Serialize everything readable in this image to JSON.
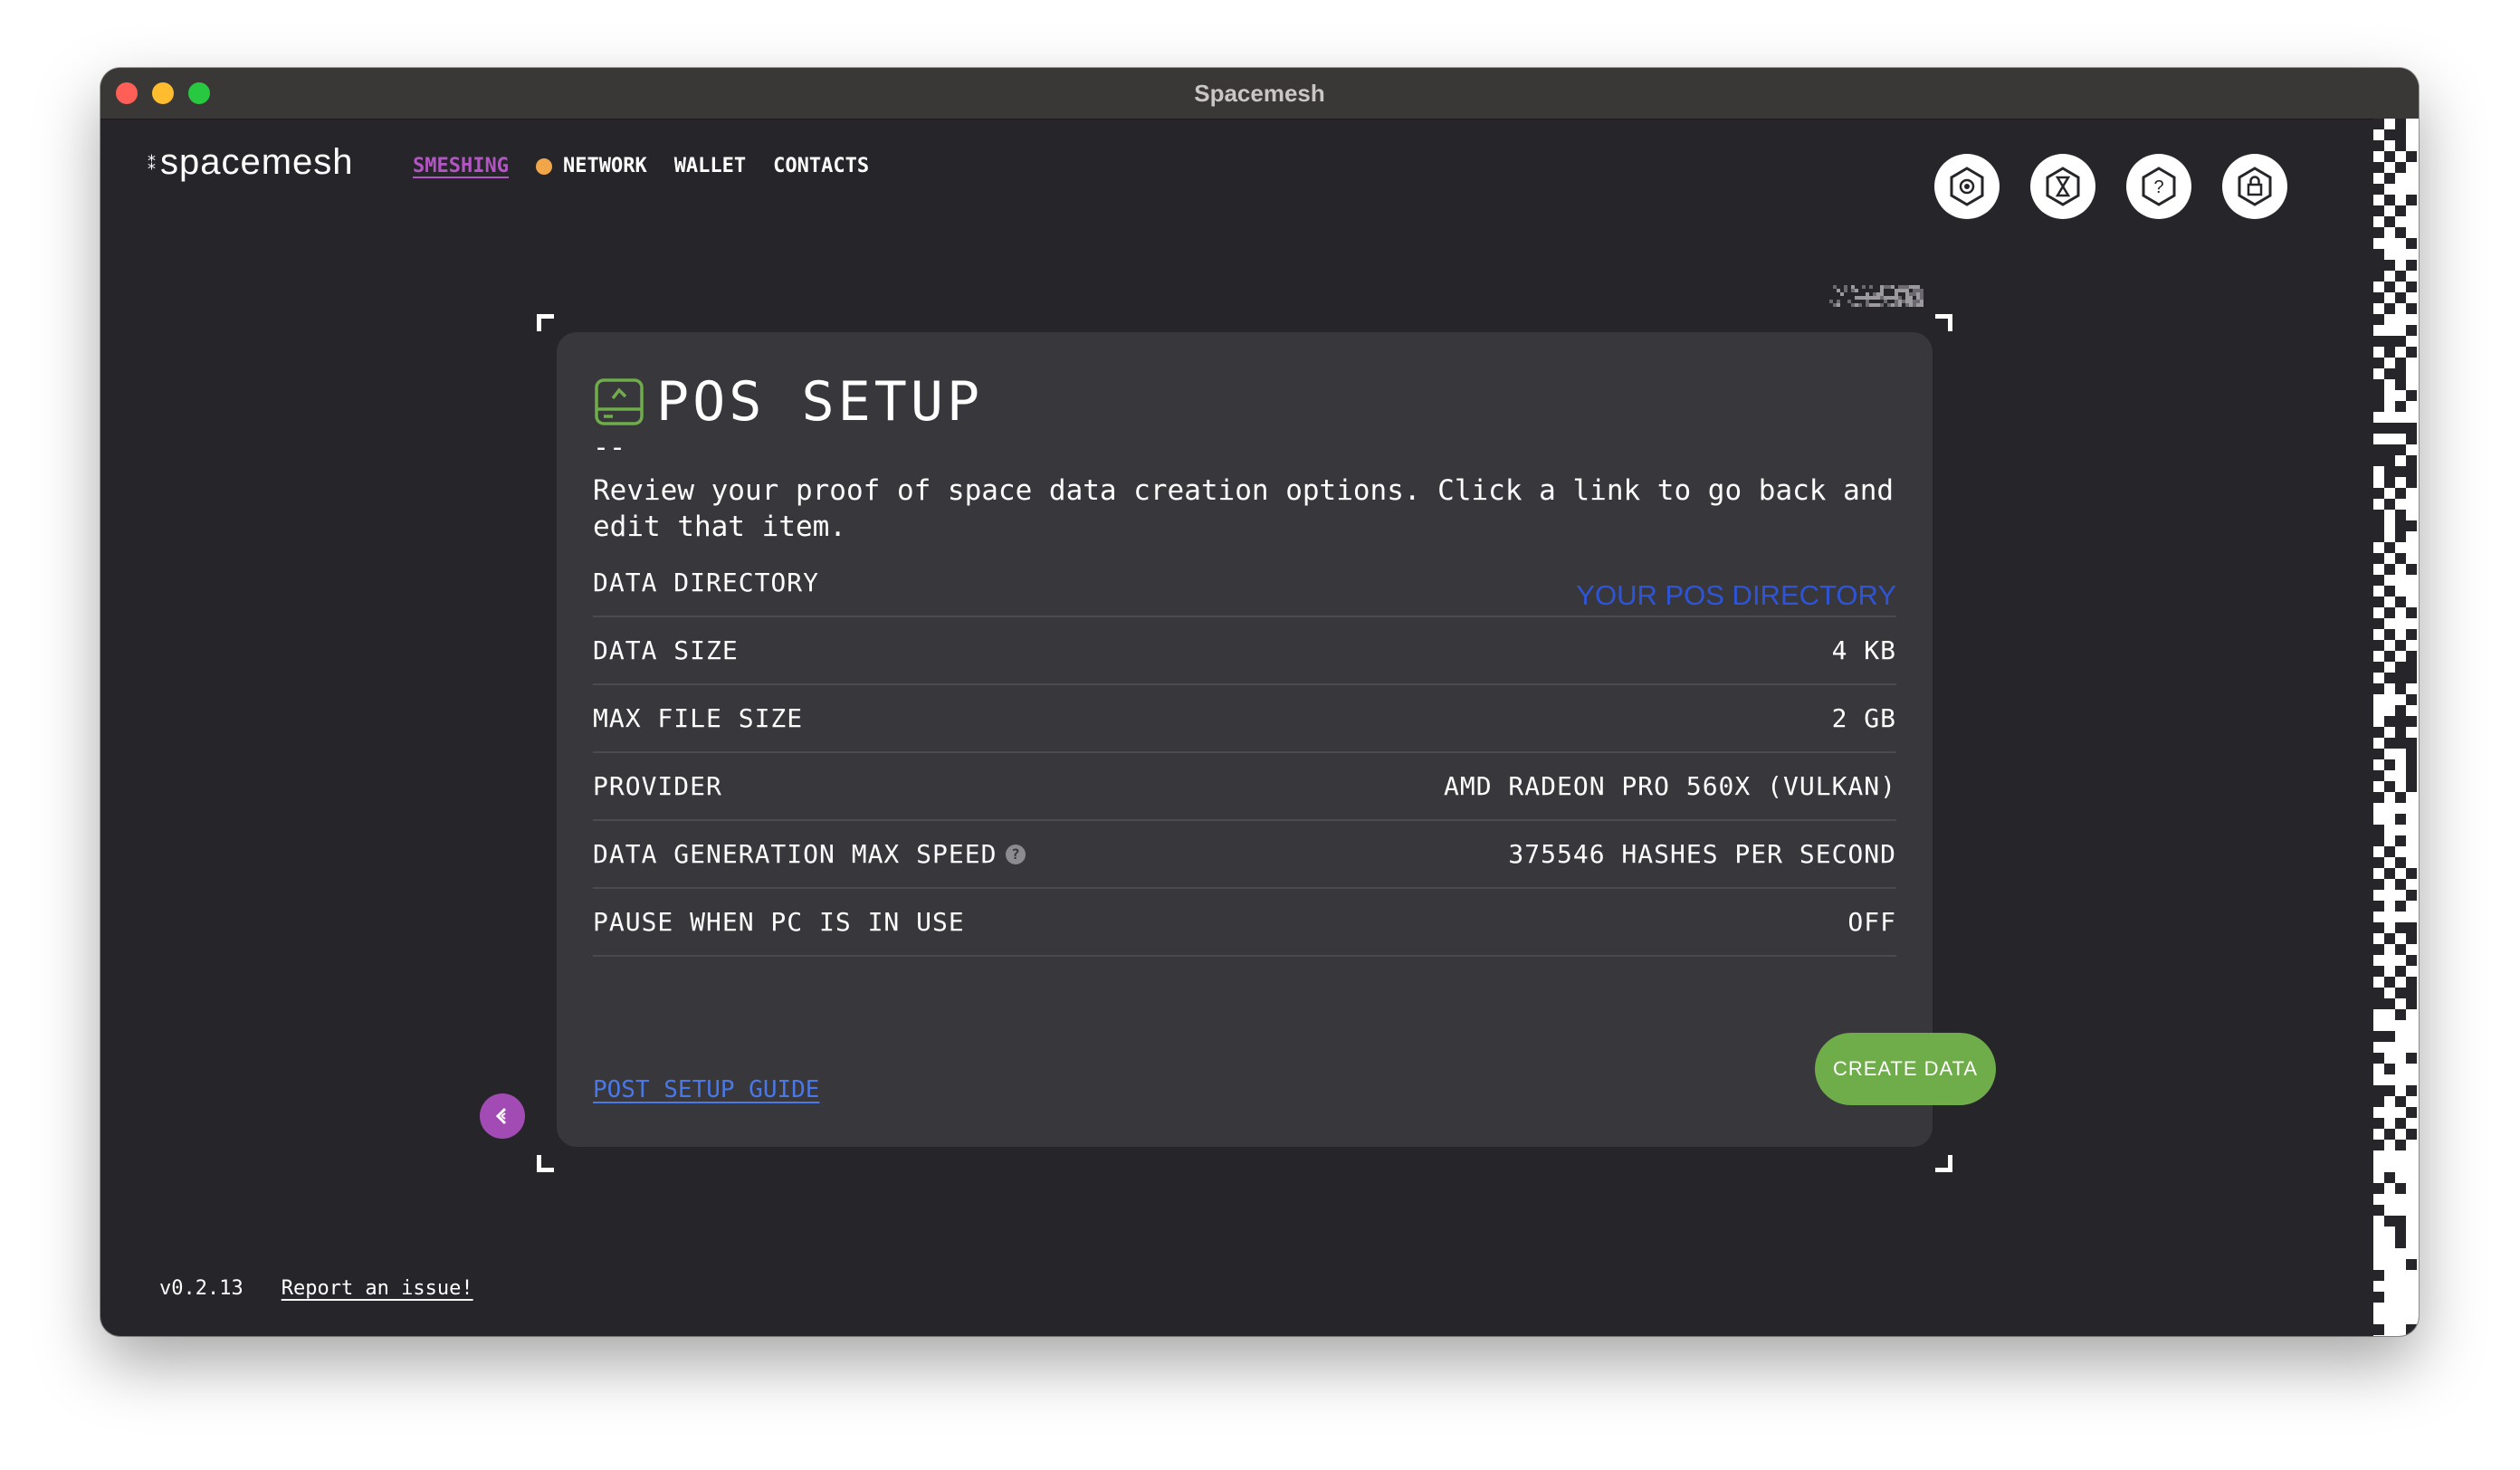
{
  "window": {
    "title": "Spacemesh"
  },
  "header": {
    "logo_text": "spacemesh",
    "logo_mark": "⁑",
    "nav": [
      {
        "label": "SMESHING",
        "active": true
      },
      {
        "label": "NETWORK",
        "status_color": "#f2a64a"
      },
      {
        "label": "WALLET"
      },
      {
        "label": "CONTACTS"
      }
    ],
    "icons": [
      "settings-hex-icon",
      "timer-hex-icon",
      "help-hex-icon",
      "lock-hex-icon"
    ]
  },
  "panel": {
    "title": "POS SETUP",
    "dash": "--",
    "description": "Review your proof of space data creation options. Click a link to go back and edit that item.",
    "rows": [
      {
        "label": "DATA DIRECTORY",
        "value": "YOUR POS DIRECTORY"
      },
      {
        "label": "DATA SIZE",
        "value": "4 KB"
      },
      {
        "label": "MAX FILE SIZE",
        "value": "2 GB"
      },
      {
        "label": "PROVIDER",
        "value": "AMD RADEON PRO 560X (VULKAN)"
      },
      {
        "label": "DATA GENERATION MAX SPEED",
        "value": "375546 HASHES PER SECOND",
        "info_glyph": "?"
      },
      {
        "label": "PAUSE WHEN PC IS IN USE",
        "value": "OFF"
      }
    ],
    "guide_link": "POST SETUP GUIDE",
    "create_button": "CREATE DATA"
  },
  "footer": {
    "version": "v0.2.13",
    "report_link": "Report an issue!"
  },
  "colors": {
    "accent_purple": "#b455c4",
    "network_dot": "#f2a64a",
    "create_green": "#6fac4a",
    "link_blue": "#2e55d8",
    "background": "#26252a",
    "panel": "#38373c"
  }
}
